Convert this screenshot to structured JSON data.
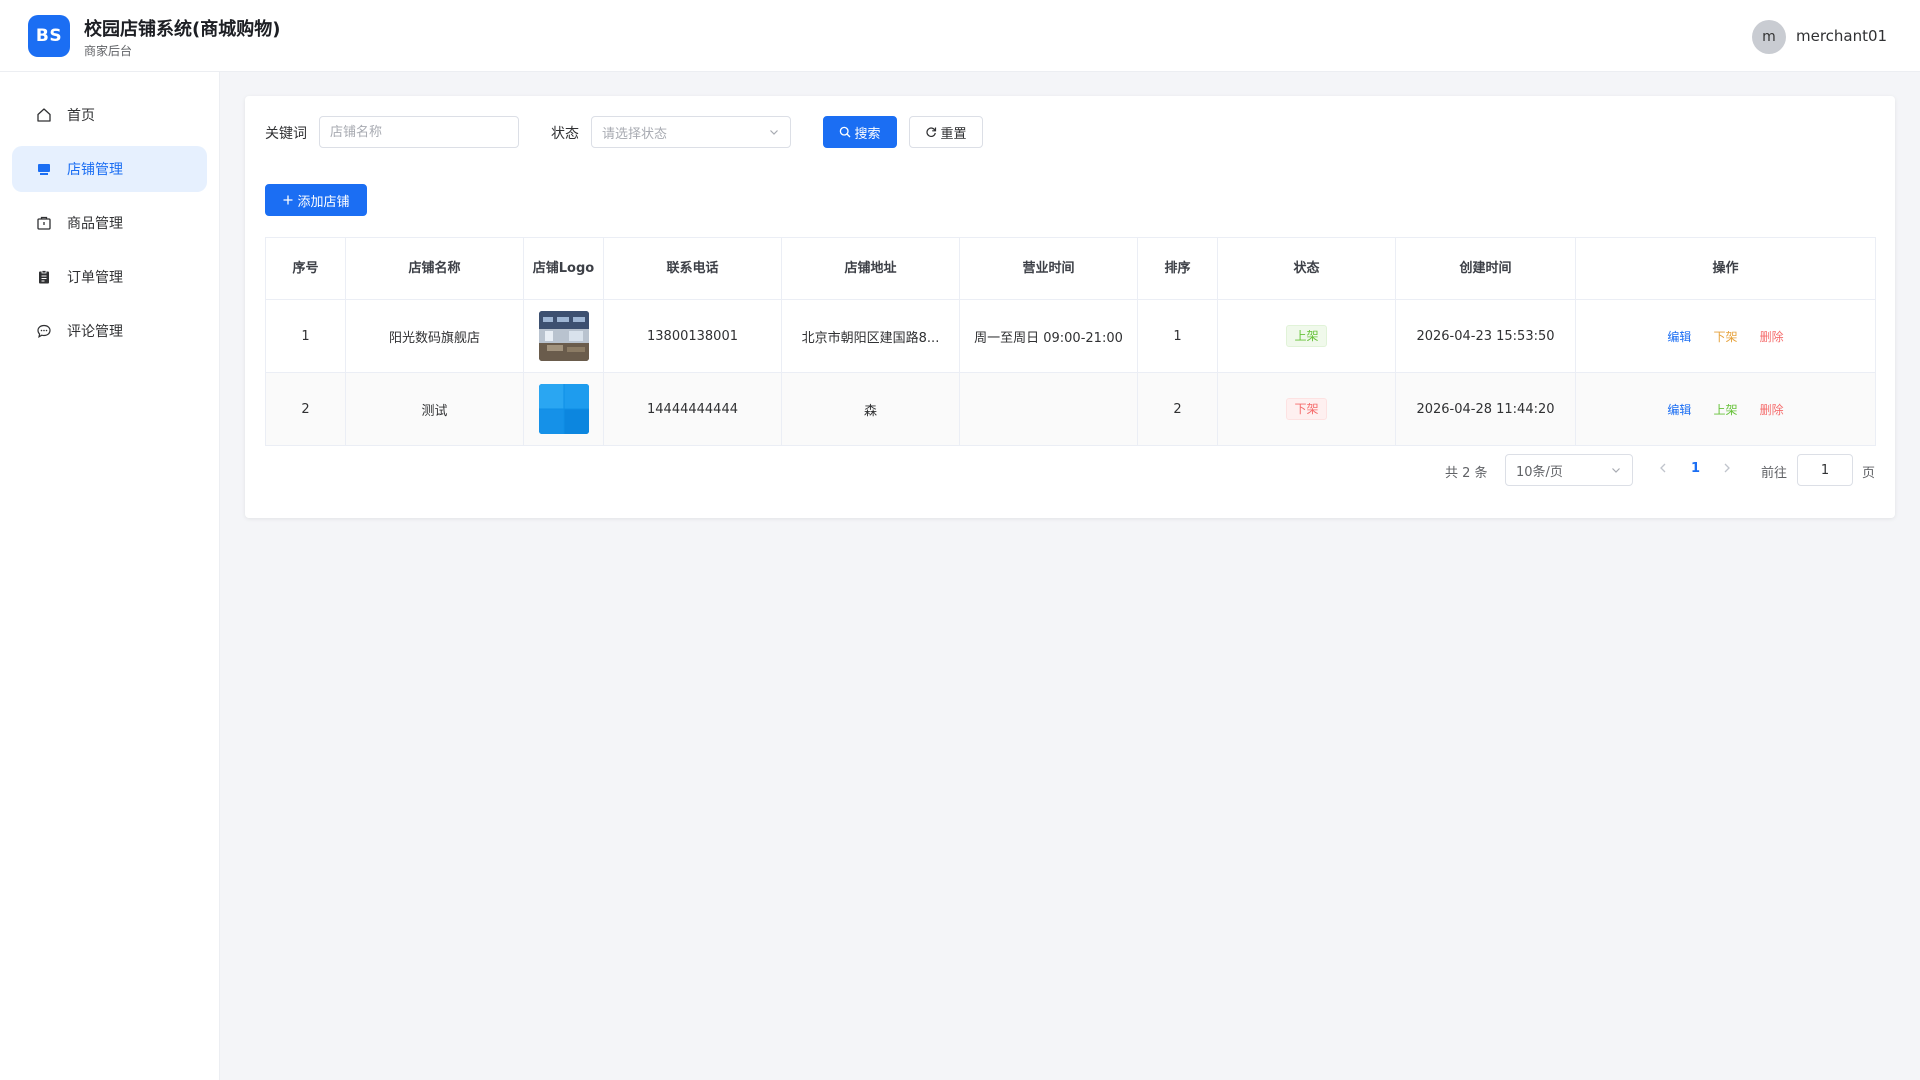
{
  "header": {
    "logo_text": "BS",
    "title": "校园店铺系统(商城购物)",
    "subtitle": "商家后台",
    "avatar_letter": "m",
    "username": "merchant01"
  },
  "sidebar": {
    "items": [
      {
        "label": "首页",
        "icon": "home-icon",
        "active": false
      },
      {
        "label": "店铺管理",
        "icon": "shop-icon",
        "active": true
      },
      {
        "label": "商品管理",
        "icon": "goods-icon",
        "active": false
      },
      {
        "label": "订单管理",
        "icon": "order-icon",
        "active": false
      },
      {
        "label": "评论管理",
        "icon": "comment-icon",
        "active": false
      }
    ]
  },
  "filters": {
    "keyword_label": "关键词",
    "keyword_placeholder": "店铺名称",
    "keyword_value": "",
    "status_label": "状态",
    "status_placeholder": "请选择状态",
    "search_button": "搜索",
    "reset_button": "重置"
  },
  "actions": {
    "add_button": "添加店铺"
  },
  "table": {
    "columns": [
      "序号",
      "店铺名称",
      "店铺Logo",
      "联系电话",
      "店铺地址",
      "营业时间",
      "排序",
      "状态",
      "创建时间",
      "操作"
    ],
    "rows": [
      {
        "index": "1",
        "name": "阳光数码旗舰店",
        "phone": "13800138001",
        "address": "北京市朝阳区建国路8...",
        "hours": "周一至周日 09:00-21:00",
        "sort": "1",
        "status": "上架",
        "created": "2026-04-23 15:53:50",
        "ops": [
          "编辑",
          "下架",
          "删除"
        ]
      },
      {
        "index": "2",
        "name": "测试",
        "phone": "14444444444",
        "address": "森",
        "hours": "",
        "sort": "2",
        "status": "下架",
        "created": "2026-04-28 11:44:20",
        "ops": [
          "编辑",
          "上架",
          "删除"
        ]
      }
    ]
  },
  "pagination": {
    "total_text": "共 2 条",
    "page_size": "10条/页",
    "current_page": "1",
    "goto_label": "前往",
    "goto_value": "1",
    "page_suffix": "页"
  },
  "colors": {
    "primary": "#1b6ef3",
    "success": "#67c23a",
    "warning": "#e6a23c",
    "danger": "#f56c6c"
  }
}
